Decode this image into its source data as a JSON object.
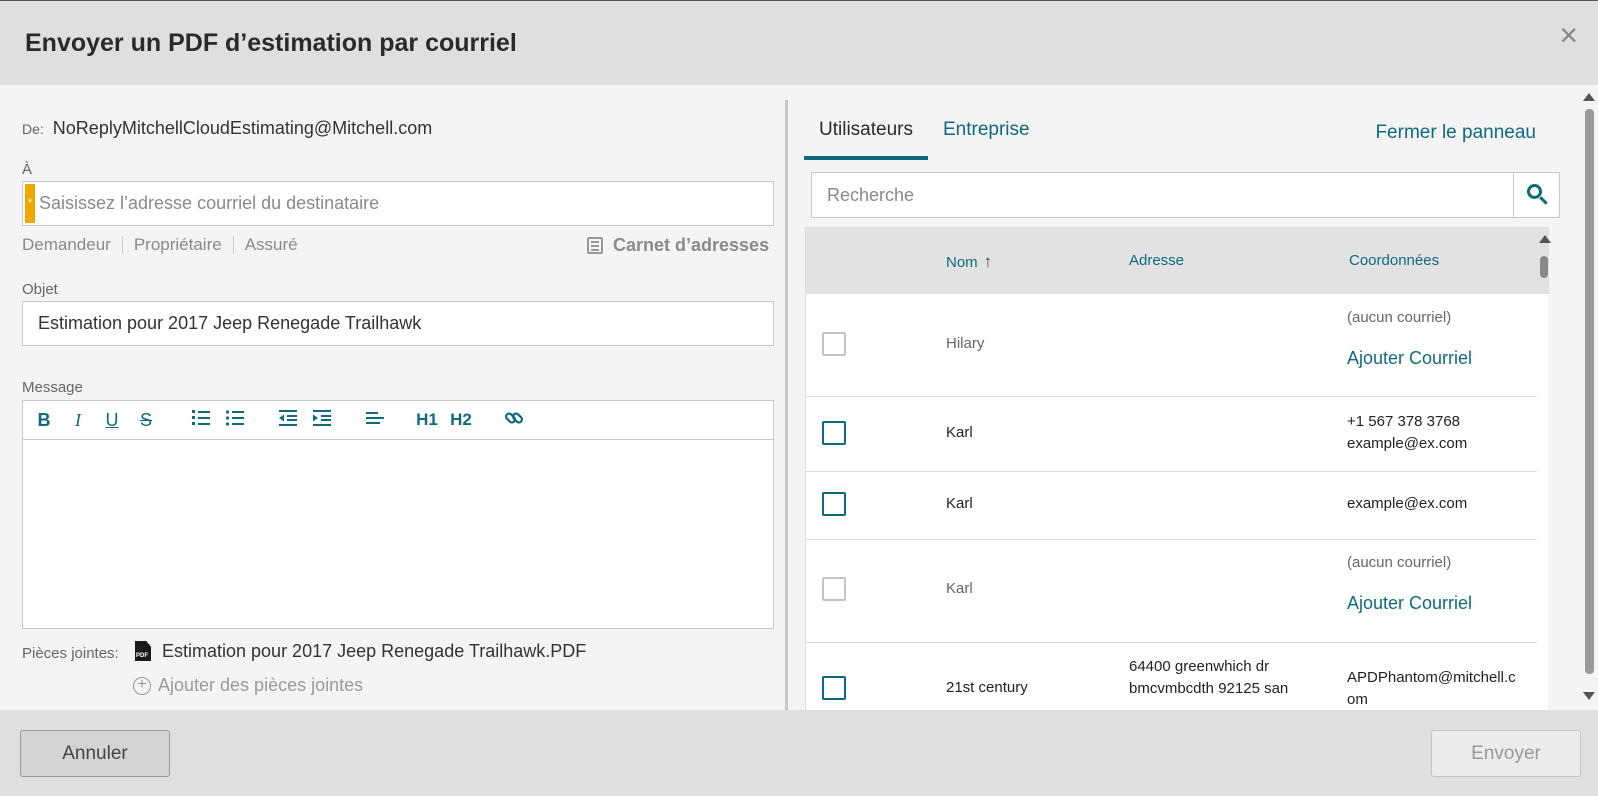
{
  "dialog": {
    "title": "Envoyer un PDF d’estimation par courriel",
    "close_glyph": "×"
  },
  "compose": {
    "from_label": "De:",
    "from_value": "NoReplyMitchellCloudEstimating@Mitchell.com",
    "to_label": "À",
    "to_required_marker": "*",
    "to_placeholder": "Saisissez l’adresse courriel du destinataire",
    "to_value": "",
    "quick_recipients": [
      "Demandeur",
      "Propriétaire",
      "Assuré"
    ],
    "address_book_label": "Carnet d’adresses",
    "subject_label": "Objet",
    "subject_value": "Estimation pour 2017 Jeep Renegade Trailhawk",
    "message_label": "Message",
    "message_value": "",
    "toolbar": {
      "bold": "B",
      "italic": "I",
      "underline": "U",
      "strike": "S",
      "ordered_list": "ordered-list-icon",
      "bullet_list": "bullet-list-icon",
      "outdent": "outdent-icon",
      "indent": "indent-icon",
      "align": "align-icon",
      "h1": "H1",
      "h2": "H2",
      "link": "link-icon"
    },
    "attachments_label": "Pièces jointes:",
    "attachment_icon_text": "PDF",
    "attachments": [
      "Estimation pour 2017 Jeep Renegade Trailhawk.PDF"
    ],
    "add_attachments_label": "Ajouter des pièces jointes"
  },
  "panel": {
    "tabs": [
      {
        "label": "Utilisateurs",
        "active": true
      },
      {
        "label": "Entreprise",
        "active": false
      }
    ],
    "close_panel_label": "Fermer le panneau",
    "search_placeholder": "Recherche",
    "table": {
      "columns": [
        "Nom",
        "Adresse",
        "Coordonnées"
      ],
      "sort_column": "Nom",
      "sort_direction": "ascending",
      "rows": [
        {
          "name": "Hilary",
          "address": "",
          "contact": [
            "(aucun courriel)"
          ],
          "action": "Ajouter Courriel",
          "enabled": false
        },
        {
          "name": "Karl",
          "address": "",
          "contact": [
            "+1 567 378 3768",
            "example@ex.com"
          ],
          "action": "",
          "enabled": true
        },
        {
          "name": "Karl",
          "address": "",
          "contact": [
            "example@ex.com"
          ],
          "action": "",
          "enabled": true
        },
        {
          "name": "Karl",
          "address": "",
          "contact": [
            "(aucun courriel)"
          ],
          "action": "Ajouter Courriel",
          "enabled": false
        },
        {
          "name": "21st century",
          "address": [
            "64400 greenwhich dr",
            "bmcvmbcdth 92125 san"
          ],
          "contact": [
            "APDPhantom@mitchell.c",
            "om"
          ],
          "action": "",
          "enabled": true
        }
      ]
    }
  },
  "footer": {
    "cancel_label": "Annuler",
    "send_label": "Envoyer"
  },
  "colors": {
    "accent": "#0f6a80",
    "required": "#f0a800",
    "header_bg": "#dfdfdf"
  }
}
